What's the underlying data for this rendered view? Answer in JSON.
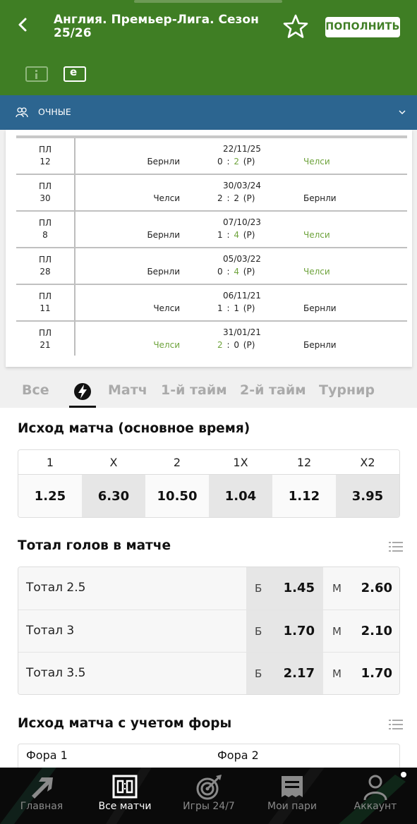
{
  "header": {
    "title": "Англия. Премьер-Лига. Сезон 25/26",
    "topup_label": "ПОПОЛНИТЬ",
    "bg_color": "#3f7e24"
  },
  "section_bar": {
    "label": "ОЧНЫЕ",
    "bg_color": "#2c6590"
  },
  "h2h": {
    "rows": [
      {
        "tour_label": "ПЛ",
        "tour_no": "12",
        "date": "22/11/25",
        "home": "Бернли",
        "score_h": "0",
        "score_a": "2",
        "note": "(Р)",
        "away": "Челси",
        "winner": "away"
      },
      {
        "tour_label": "ПЛ",
        "tour_no": "30",
        "date": "30/03/24",
        "home": "Челси",
        "score_h": "2",
        "score_a": "2",
        "note": "(Р)",
        "away": "Бернли",
        "winner": "none"
      },
      {
        "tour_label": "ПЛ",
        "tour_no": "8",
        "date": "07/10/23",
        "home": "Бернли",
        "score_h": "1",
        "score_a": "4",
        "note": "(Р)",
        "away": "Челси",
        "winner": "away"
      },
      {
        "tour_label": "ПЛ",
        "tour_no": "28",
        "date": "05/03/22",
        "home": "Бернли",
        "score_h": "0",
        "score_a": "4",
        "note": "(Р)",
        "away": "Челси",
        "winner": "away"
      },
      {
        "tour_label": "ПЛ",
        "tour_no": "11",
        "date": "06/11/21",
        "home": "Челси",
        "score_h": "1",
        "score_a": "1",
        "note": "(Р)",
        "away": "Бернли",
        "winner": "none"
      },
      {
        "tour_label": "ПЛ",
        "tour_no": "21",
        "date": "31/01/21",
        "home": "Челси",
        "score_h": "2",
        "score_a": "0",
        "note": "(Р)",
        "away": "Бернли",
        "winner": "home"
      }
    ]
  },
  "tabs": {
    "all": "Все",
    "match": "Матч",
    "half1": "1-й тайм",
    "half2": "2-й тайм",
    "tournament": "Турнир"
  },
  "outcome": {
    "title": "Исход матча (основное время)",
    "labels": [
      "1",
      "X",
      "2",
      "1X",
      "12",
      "X2"
    ],
    "odds": [
      "1.25",
      "6.30",
      "10.50",
      "1.04",
      "1.12",
      "3.95"
    ]
  },
  "totals": {
    "title": "Тотал голов в матче",
    "rows": [
      {
        "name": "Тотал 2.5",
        "over_label": "Б",
        "over": "1.45",
        "under_label": "М",
        "under": "2.60"
      },
      {
        "name": "Тотал 3",
        "over_label": "Б",
        "over": "1.70",
        "under_label": "М",
        "under": "2.10"
      },
      {
        "name": "Тотал 3.5",
        "over_label": "Б",
        "over": "2.17",
        "under_label": "М",
        "under": "1.70"
      }
    ]
  },
  "handicap": {
    "title": "Исход матча с учетом форы",
    "col1": "Фора 1",
    "col2": "Фора 2"
  },
  "nav": {
    "items": [
      {
        "label": "Главная",
        "icon": "arrow-icon"
      },
      {
        "label": "Все матчи",
        "icon": "scoreboard-icon"
      },
      {
        "label": "Игры 24/7",
        "icon": "target-icon"
      },
      {
        "label": "Мои пари",
        "icon": "ticket-icon"
      },
      {
        "label": "Аккаунт",
        "icon": "user-icon"
      }
    ],
    "active": 1
  }
}
